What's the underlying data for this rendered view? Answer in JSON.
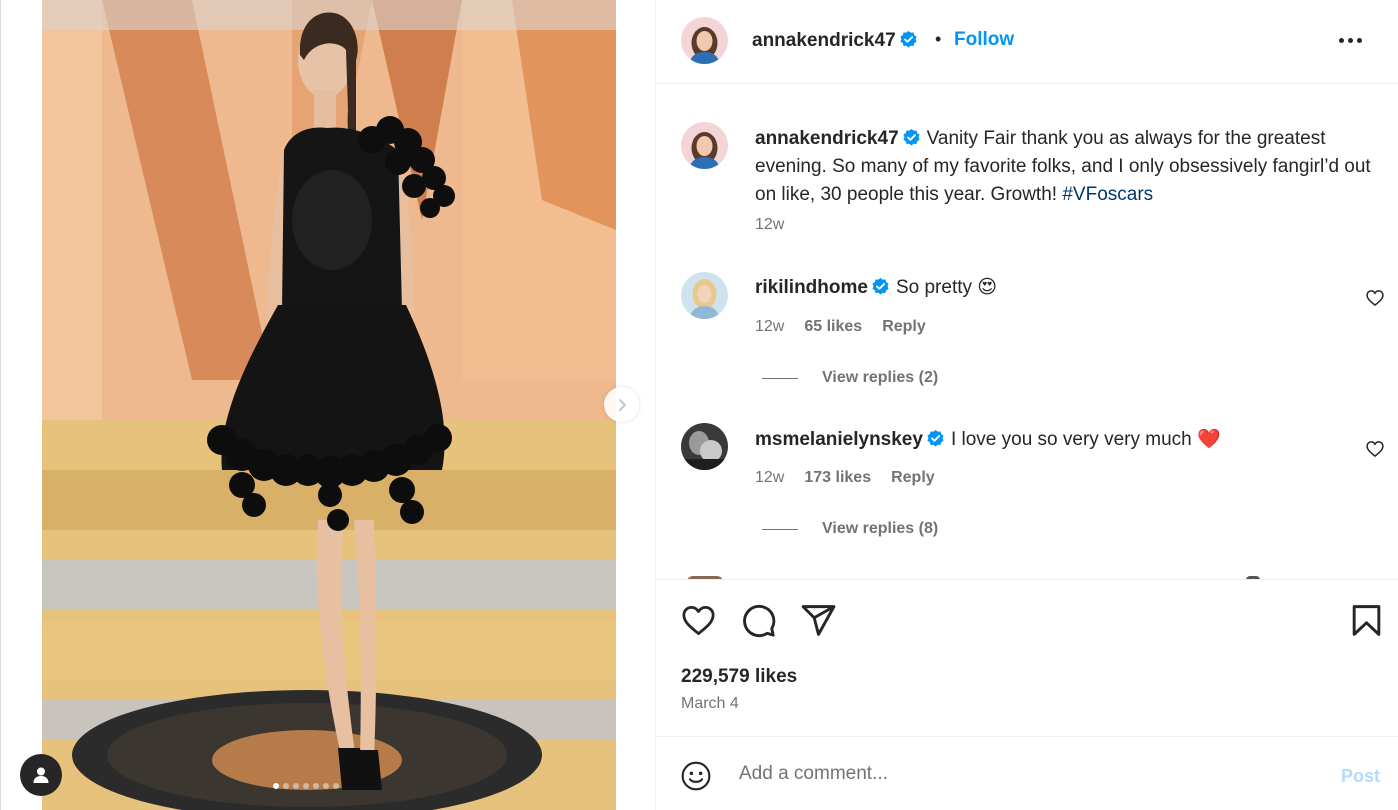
{
  "colors": {
    "link": "#0095f6",
    "hashtag": "#00376b",
    "muted": "#737373",
    "verified": "#0095f6",
    "heart_red": "#ed4956"
  },
  "media": {
    "carousel": {
      "total": 7,
      "active": 0
    },
    "icons": {
      "next": "chevron-right-icon",
      "tag": "person-tag-icon"
    }
  },
  "header": {
    "username": "annakendrick47",
    "separator": "•",
    "follow_label": "Follow",
    "icons": {
      "verified": "verified-badge-icon",
      "more": "more-options-icon"
    }
  },
  "caption": {
    "username": "annakendrick47",
    "text": "Vanity Fair thank you as always for the greatest evening. So many of my favorite folks, and I only obsessively fangirl’d out on like, 30 people this year. Growth! ",
    "hashtag": "#VFoscars",
    "time": "12w"
  },
  "comments": [
    {
      "username": "rikilindhome",
      "text": "So pretty",
      "emoji": "😍",
      "time": "12w",
      "likes": "65 likes",
      "reply_label": "Reply",
      "view_replies": "View replies (2)"
    },
    {
      "username": "msmelanielynskey",
      "text": "I love you so very very much",
      "emoji": "❤️",
      "time": "12w",
      "likes": "173 likes",
      "reply_label": "Reply",
      "view_replies": "View replies (8)"
    }
  ],
  "actions": {
    "likes": "229,579 likes",
    "date": "March 4",
    "icons": [
      "heart-icon",
      "comment-icon",
      "share-icon",
      "bookmark-icon"
    ]
  },
  "add_comment": {
    "placeholder": "Add a comment...",
    "post_label": "Post",
    "icons": {
      "emoji": "emoji-smile-icon"
    }
  }
}
